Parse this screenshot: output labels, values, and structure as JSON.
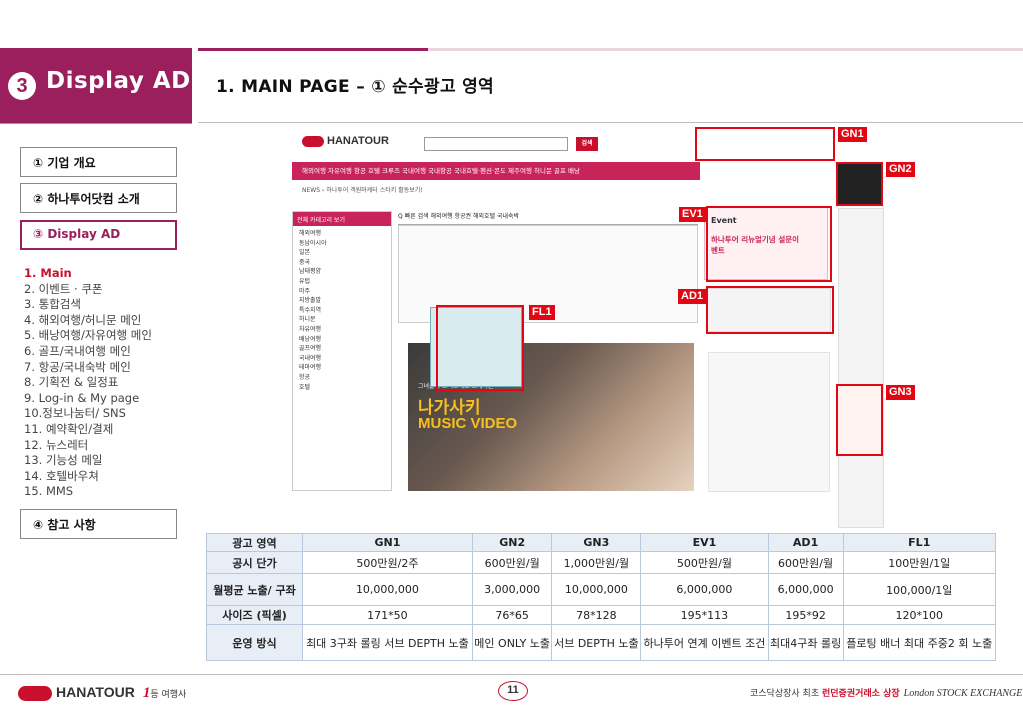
{
  "section": {
    "number": "3",
    "title": "Display AD"
  },
  "page_title": "1. MAIN PAGE – ① 순수광고 영역",
  "menu": [
    {
      "label": "① 기업 개요"
    },
    {
      "label": "② 하나투어닷컴 소개"
    },
    {
      "label": "③ Display AD"
    },
    {
      "label": "④ 참고 사항"
    }
  ],
  "sub_menu": [
    "1. Main",
    "2. 이벤트 · 쿠폰",
    "3. 통합검색",
    "4. 해외여행/허니문 메인",
    "5. 배낭여행/자유여행 메인",
    "6. 골프/국내여행 메인",
    "7. 항공/국내숙박 메인",
    "8. 기획전 & 일정표",
    "9. Log-in & My page",
    "10.정보나눔터/ SNS",
    "11. 예약확인/결제",
    "12. 뉴스레터",
    "13. 기능성 메일",
    "14. 호텔바우쳐",
    "15. MMS"
  ],
  "mock": {
    "logo": "HANATOUR",
    "search_btn": "검색",
    "nav": "해외여행   자유여행   항공   호텔   크루즈        국내여행   국내항공   국내호텔·펜션·콘도   제주여행        허니문   골프   배낭",
    "news": "NEWS › 하나투어 객원마케터 스타키 활동보기!",
    "lnav_head": "전체 카테고리 보기",
    "lnav_items": [
      "해외여행",
      "동남아시아",
      "일본",
      "중국",
      "남태평양",
      "유럽",
      "미주",
      "지방출발",
      "특수지역",
      "허니문",
      "자유여행",
      "배낭여행",
      "골프여행",
      "국내여행",
      "테마여행",
      "항공",
      "호텔"
    ],
    "tabs": "Q 빠른 검색   해외여행   항공권   해외호텔   국내숙박",
    "promo_sub": "그녀들이 코믹노래로 소개하는",
    "promo_title": "나가사키",
    "promo_title2": "MUSIC VIDEO",
    "ev1_title": "Event",
    "ev1_line": "하나투어 리뉴얼기념 설문이벤트"
  },
  "callouts": {
    "gn1": "GN1",
    "gn2": "GN2",
    "gn3": "GN3",
    "ev1": "EV1",
    "ad1": "AD1",
    "fl1": "FL1"
  },
  "table": {
    "headers": [
      "광고 영역",
      "GN1",
      "GN2",
      "GN3",
      "EV1",
      "AD1",
      "FL1"
    ],
    "rows": [
      {
        "label": "공시 단가",
        "cells": [
          "500만원/2주",
          "600만원/월",
          "1,000만원/월",
          "500만원/월",
          "600만원/월",
          "100만원/1일"
        ]
      },
      {
        "label": "월평균 노출/ 구좌",
        "cells": [
          "10,000,000",
          "3,000,000",
          "10,000,000",
          "6,000,000",
          "6,000,000",
          "100,000/1일"
        ]
      },
      {
        "label": "사이즈 (픽셀)",
        "cells": [
          "171*50",
          "76*65",
          "78*128",
          "195*113",
          "195*92",
          "120*100"
        ]
      },
      {
        "label": "운영 방식",
        "cells": [
          "최대 3구좌 롤링 서브 DEPTH 노출",
          "메인 ONLY 노출",
          "서브 DEPTH 노출",
          "하나투어 연계 이벤트 조건",
          "최대4구좌 롤링",
          "플로팅 배너 최대 주중2 회 노출"
        ]
      }
    ]
  },
  "footer": {
    "logo": "HANATOUR",
    "tagline_num": "1",
    "tagline": "등 여행사",
    "page": "11",
    "right_plain": "코스닥상장사 최초",
    "right_bold": "런던증권거래소 상장",
    "right_lse": "London STOCK EXCHANGE"
  },
  "colors": {
    "brand": "#9b1f5d",
    "callout": "#e30613",
    "table_header": "#e8eef6"
  }
}
